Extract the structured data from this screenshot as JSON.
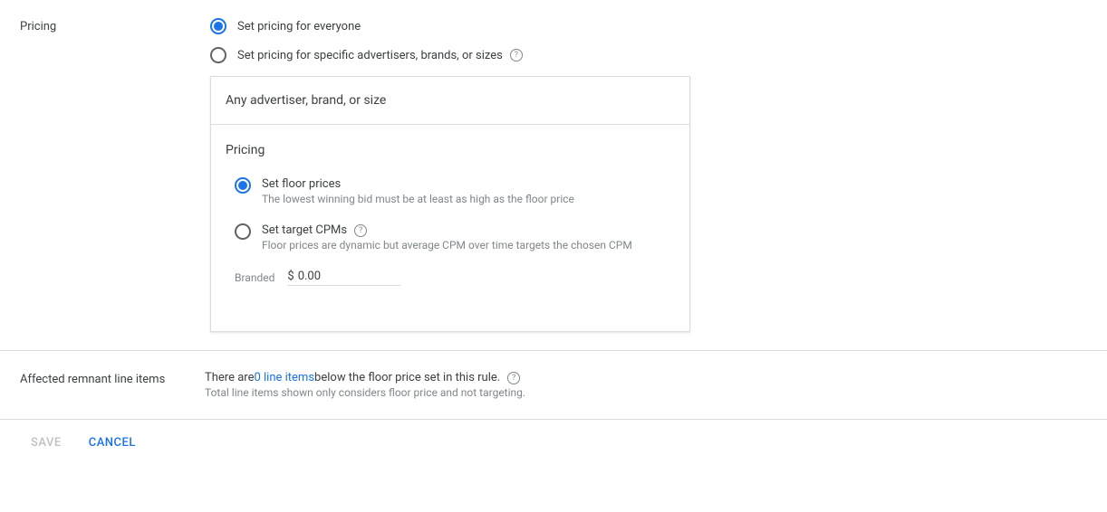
{
  "pricing": {
    "section_label": "Pricing",
    "option_everyone": "Set pricing for everyone",
    "option_specific": "Set pricing for specific advertisers, brands, or sizes",
    "card_header": "Any advertiser, brand, or size",
    "card_title": "Pricing",
    "floor_option_label": "Set floor prices",
    "floor_option_desc": "The lowest winning bid must be at least as high as the floor price",
    "cpm_option_label": "Set target CPMs",
    "cpm_option_desc": "Floor prices are dynamic but average CPM over time targets the chosen CPM",
    "branded_label": "Branded",
    "currency_symbol": "$",
    "price_value": "0.00"
  },
  "affected": {
    "section_label": "Affected remnant line items",
    "prefix": "There are ",
    "link_text": "0 line items",
    "suffix": " below the floor price set in this rule.",
    "sub": "Total line items shown only considers floor price and not targeting."
  },
  "footer": {
    "save": "SAVE",
    "cancel": "CANCEL"
  }
}
